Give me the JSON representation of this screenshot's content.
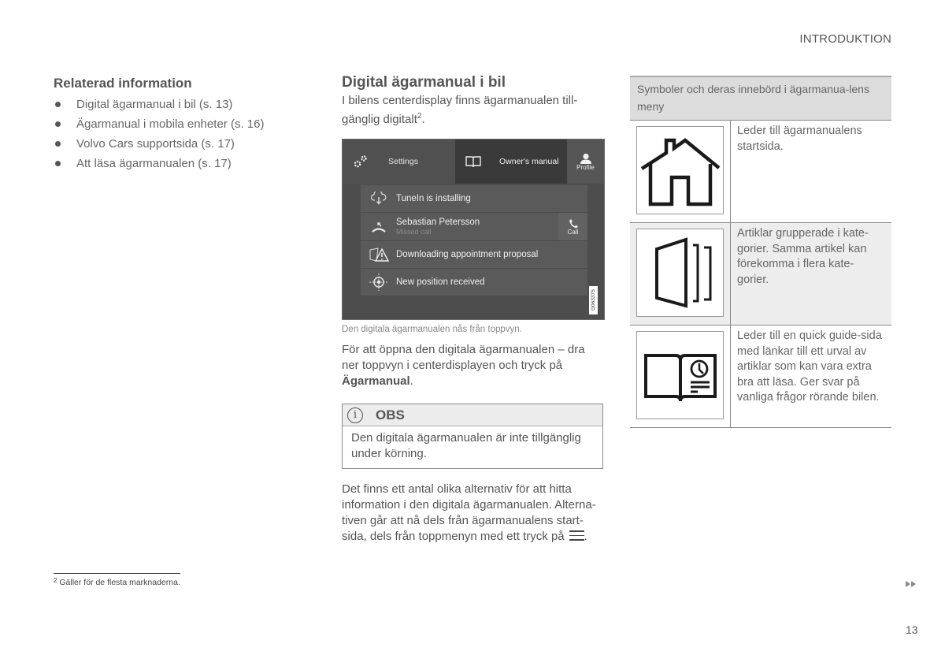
{
  "page": {
    "section_header": "INTRODUKTION",
    "page_number": "13"
  },
  "related": {
    "title": "Relaterad information",
    "items": [
      "Digital ägarmanual i bil (s. 13)",
      "Ägarmanual i mobila enheter (s. 16)",
      "Volvo Cars supportsida (s. 17)",
      "Att läsa ägarmanualen (s. 17)"
    ]
  },
  "footnote": {
    "number": "2",
    "text": "Gäller för de flesta marknaderna."
  },
  "main": {
    "title": "Digital ägarmanual i bil",
    "intro": "I bilens centerdisplay finns ägarmanualen till-gänglig digitalt",
    "intro_sup": "2",
    "intro_end": ".",
    "screen": {
      "settings_label": "Settings",
      "manual_label": "Owner's manual",
      "profile_label": "Profile",
      "notifications": [
        {
          "icon": "cloud-download-icon",
          "text": "TuneIn is installing"
        },
        {
          "icon": "missed-call-icon",
          "text": "Sebastian Petersson",
          "subtext": "Missed call",
          "action": "Call"
        },
        {
          "icon": "warning-icon",
          "text": "Downloading appointment proposal"
        },
        {
          "icon": "gps-position-icon",
          "text": "New position received"
        }
      ],
      "image_code": "G063375"
    },
    "caption": "Den digitala ägarmanualen nås från toppvyn.",
    "para1": "För att öppna den digitala ägarmanualen – dra ner toppvyn i centerdisplayen och tryck på ",
    "para1_bold": "Ägarmanual",
    "para1_end": ".",
    "note": {
      "title": "OBS",
      "text": "Den digitala ägarmanualen är inte tillgänglig under körning."
    },
    "para2": "Det finns ett antal olika alternativ för att hitta information i den digitala ägarmanualen. Alterna-tiven går att nå dels från ägarmanualens start-sida, dels från toppmenyn med ett tryck på",
    "para2_end": "."
  },
  "symbols": {
    "header": "Symboler och deras innebörd i ägarmanua-lens meny",
    "rows": [
      {
        "icon": "home-icon",
        "text": "Leder till ägarmanualens startsida."
      },
      {
        "icon": "categories-icon",
        "text": "Artiklar grupperade i kate-gorier. Samma artikel kan förekomma i flera kate-gorier."
      },
      {
        "icon": "quick-guide-icon",
        "text": "Leder till en quick guide-sida med länkar till ett urval av artiklar som kan vara extra bra att läsa. Ger svar på vanliga frågor rörande bilen."
      }
    ]
  }
}
